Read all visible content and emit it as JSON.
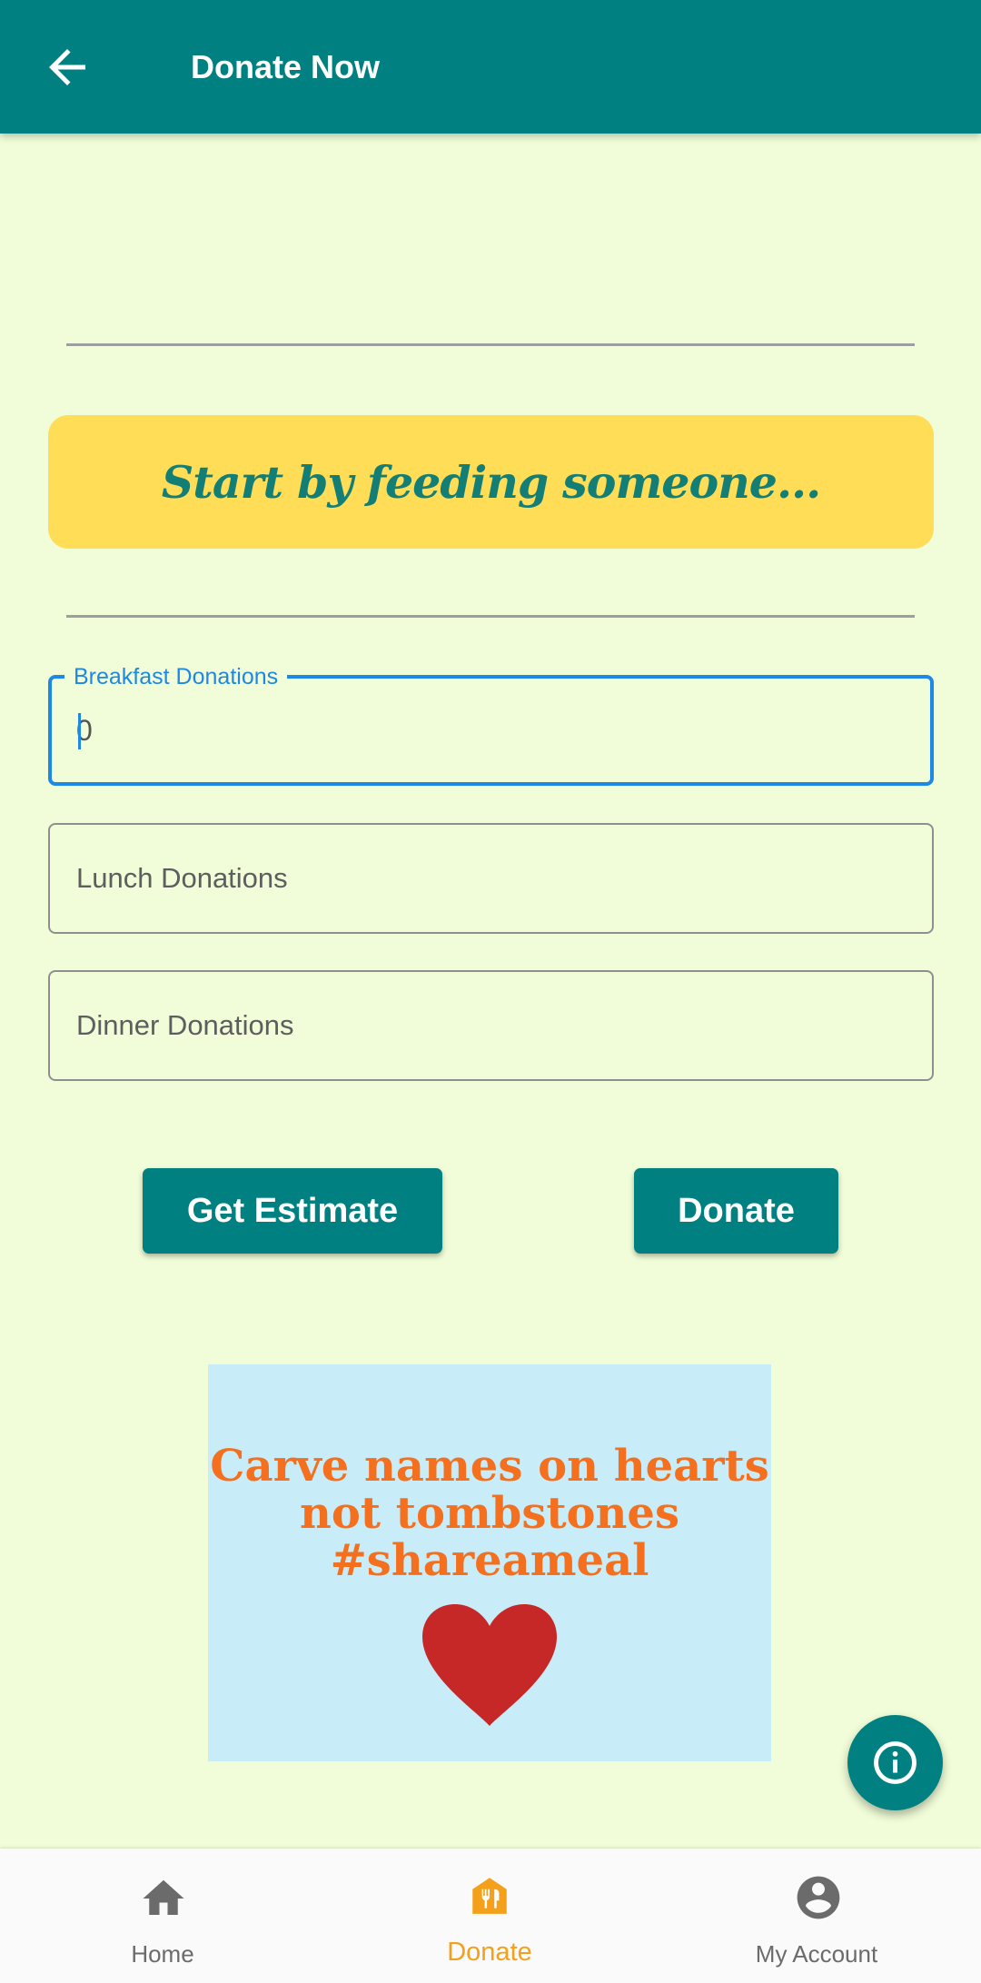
{
  "appbar": {
    "title": "Donate Now",
    "back_icon": "arrow-back-icon"
  },
  "banner": {
    "text": "Start by feeding someone..."
  },
  "form": {
    "breakfast": {
      "label": "Breakfast Donations",
      "value": "0"
    },
    "lunch": {
      "label": "Lunch Donations"
    },
    "dinner": {
      "label": "Dinner Donations"
    }
  },
  "buttons": {
    "estimate_label": "Get Estimate",
    "donate_label": "Donate"
  },
  "poster": {
    "line1": "Carve names on hearts",
    "line2": "not tombstones",
    "line3": "#shareameal",
    "heart_icon": "heart-icon"
  },
  "fab": {
    "icon": "info-icon"
  },
  "bottom_nav": {
    "items": [
      {
        "label": "Home",
        "icon": "home-icon",
        "active": false
      },
      {
        "label": "Donate",
        "icon": "restaurant-icon",
        "active": true
      },
      {
        "label": "My Account",
        "icon": "account-circle-icon",
        "active": false
      }
    ]
  },
  "colors": {
    "primary": "#008080",
    "background": "#F0FDD8",
    "banner": "#FFDD57",
    "accent_orange": "#F5A01A",
    "focus_blue": "#1E88E5",
    "heart": "#C62828"
  }
}
